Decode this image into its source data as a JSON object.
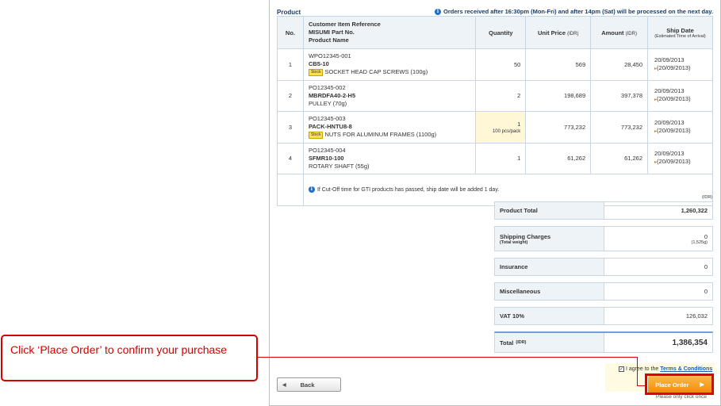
{
  "section": {
    "title": "Product",
    "notice": "Orders received after 16:30pm (Mon-Fri) and after 14pm (Sat) will be processed on the next day."
  },
  "table": {
    "headers": {
      "no": "No.",
      "item_line1": "Customer Item Reference",
      "item_line2": "MISUMI Part No.",
      "item_line3": "Product Name",
      "quantity": "Quantity",
      "unit_price": "Unit Price",
      "unit_price_unit": "(IDR)",
      "amount": "Amount",
      "amount_unit": "(IDR)",
      "ship_date": "Ship Date",
      "ship_date_sub": "(Estimated Time of Arrival)"
    },
    "rows": [
      {
        "no": "1",
        "ref": "WPO12345-001",
        "part_no": "CB5-10",
        "stock": "Stock",
        "name": "SOCKET HEAD CAP SCREWS (100g)",
        "quantity": "50",
        "qty_sub": "",
        "unit_price": "569",
        "amount": "28,450",
        "ship_date": "20/09/2013",
        "eta": "(20/09/2013)"
      },
      {
        "no": "2",
        "ref": "PO12345-002",
        "part_no": "MBRDFA40-2-H5",
        "stock": "",
        "name": "PULLEY (70g)",
        "quantity": "2",
        "qty_sub": "",
        "unit_price": "198,689",
        "amount": "397,378",
        "ship_date": "20/09/2013",
        "eta": "(20/09/2013)"
      },
      {
        "no": "3",
        "ref": "PO12345-003",
        "part_no": "PACK-HNTU8-8",
        "stock": "Stock",
        "name": "NUTS FOR ALUMINUM FRAMES (1100g)",
        "quantity": "1",
        "qty_sub": "100 pcs/pack",
        "unit_price": "773,232",
        "amount": "773,232",
        "ship_date": "20/09/2013",
        "eta": "(20/09/2013)"
      },
      {
        "no": "4",
        "ref": "PO12345-004",
        "part_no": "SFMR10-100",
        "stock": "",
        "name": "ROTARY SHAFT (55g)",
        "quantity": "1",
        "qty_sub": "",
        "unit_price": "61,262",
        "amount": "61,262",
        "ship_date": "20/09/2013",
        "eta": "(20/09/2013)"
      }
    ],
    "note": "If Cut-Off time for GTI products has passed, ship date will be added 1 day."
  },
  "summary": {
    "currency": "(IDR)",
    "product_total_label": "Product Total",
    "product_total_value": "1,260,322",
    "shipping_label": "Shipping Charges",
    "shipping_sub": "(Total weight)",
    "shipping_value": "0",
    "shipping_weight": "(1,525g)",
    "insurance_label": "Insurance",
    "insurance_value": "0",
    "misc_label": "Miscellaneous",
    "misc_value": "0",
    "vat_label": "VAT 10%",
    "vat_value": "126,032",
    "total_label": "Total",
    "total_unit": "(IDR)",
    "total_value": "1,386,354"
  },
  "actions": {
    "back_label": "Back",
    "agree_prefix": "I agree to the",
    "terms_link": "Terms & Conditions",
    "place_order_label": "Place Order",
    "click_once": "Please only click once"
  },
  "callout": {
    "text": "Click ‘Place Order’ to confirm your purchase"
  },
  "colors": {
    "accent_orange": "#f08c00",
    "callout_red": "#d70000",
    "header_blue": "#1a3e66"
  }
}
